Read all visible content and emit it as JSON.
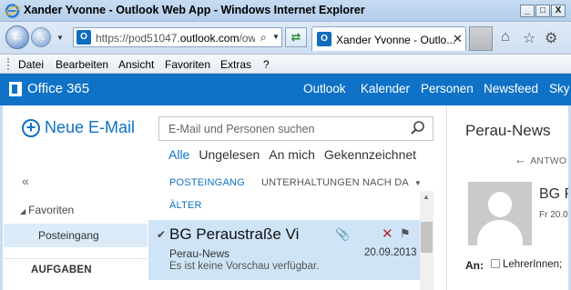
{
  "window": {
    "title": "Xander Yvonne - Outlook Web App - Windows Internet Explorer",
    "min_glyph": "_",
    "max_glyph": "□",
    "close_glyph": "X"
  },
  "browser": {
    "url_prefix": "https://pod51047.",
    "url_domain": "outlook.com",
    "url_suffix": "/owa",
    "tab_label": "Xander Yvonne - Outlo...",
    "tab_close": "✕",
    "icon_letter": "O"
  },
  "menu": {
    "items": [
      "Datei",
      "Bearbeiten",
      "Ansicht",
      "Favoriten",
      "Extras",
      "?"
    ]
  },
  "o365": {
    "brand": "Office 365",
    "nav": [
      "Outlook",
      "Kalender",
      "Personen",
      "Newsfeed",
      "Sky"
    ]
  },
  "mail": {
    "new_mail_label": "Neue E-Mail",
    "collapse_glyph": "«",
    "favorites_label": "Favoriten",
    "inbox_label": "Posteingang",
    "tasks_label": "AUFGABEN",
    "search_placeholder": "E-Mail und Personen suchen",
    "filters": [
      "Alle",
      "Ungelesen",
      "An mich",
      "Gekennzeichnet"
    ],
    "folder_label": "POSTEINGANG",
    "conversation_label": "UNTERHALTUNGEN NACH DA",
    "older_label": "ÄLTER",
    "message": {
      "subject": "BG Peraustraße Vi",
      "sender": "Perau-News",
      "date": "20.09.2013",
      "preview": "Es ist keine Vorschau verfügbar."
    }
  },
  "reading": {
    "title": "Perau-News",
    "reply_label": "ANTWO",
    "sender": "BG P",
    "date": "Fr 20.0",
    "to_label": "An:",
    "to_recipient": "LehrerInnen;"
  },
  "colors": {
    "accent": "#0f72c6",
    "selected_row": "#cfe4f7",
    "delete": "#b3262b"
  }
}
